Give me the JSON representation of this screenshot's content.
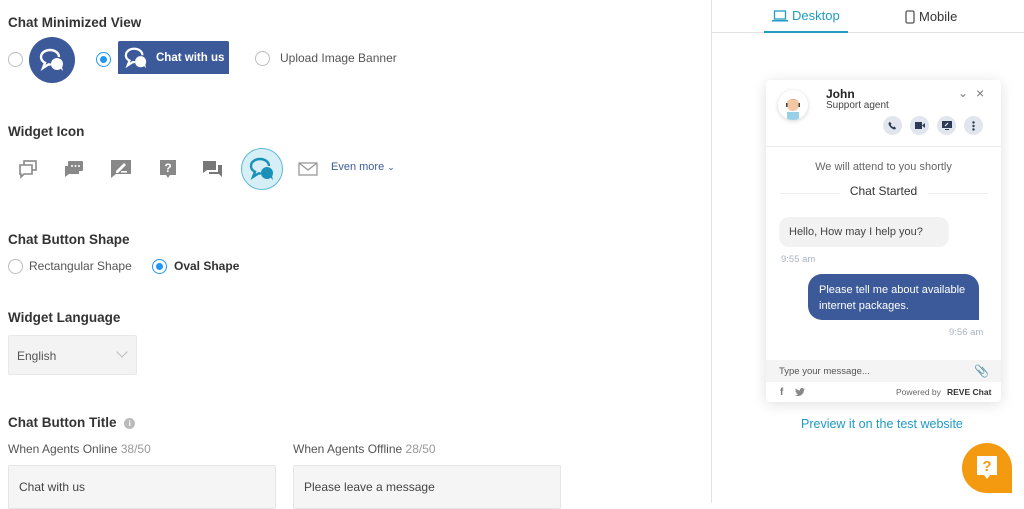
{
  "minimized_view": {
    "title": "Chat Minimized View",
    "options": [
      {
        "type": "round-icon",
        "selected": false
      },
      {
        "type": "rectangle",
        "label": "Chat with us",
        "selected": true
      },
      {
        "type": "banner",
        "label": "Upload Image Banner",
        "selected": false
      }
    ],
    "brand_color": "#3c5a99"
  },
  "widget_icon": {
    "title": "Widget Icon",
    "icons": [
      "chat-bubbles-outline-icon",
      "chat-dots-icon",
      "chat-pencil-icon",
      "chat-question-icon",
      "chat-double-icon",
      "chat-bubbles-selected-icon",
      "envelope-icon"
    ],
    "selected_index": 5,
    "even_more_label": "Even more"
  },
  "button_shape": {
    "title": "Chat Button Shape",
    "options": [
      {
        "label": "Rectangular Shape",
        "selected": false
      },
      {
        "label": "Oval Shape",
        "selected": true
      }
    ]
  },
  "language": {
    "title": "Widget Language",
    "selected": "English"
  },
  "button_title": {
    "title": "Chat Button Title",
    "online_label": "When Agents Online",
    "online_count": "38/50",
    "online_value": "Chat with us",
    "offline_label": "When Agents Offline",
    "offline_count": "28/50",
    "offline_value": "Please leave a message"
  },
  "preview": {
    "tabs": [
      {
        "label": "Desktop",
        "active": true
      },
      {
        "label": "Mobile",
        "active": false
      }
    ],
    "agent_name": "John",
    "agent_role": "Support agent",
    "system_message": "We will attend to you shortly",
    "chat_started": "Chat Started",
    "messages": [
      {
        "from": "agent",
        "text": "Hello, How may I help you?",
        "time": "9:55 am"
      },
      {
        "from": "visitor",
        "text": "Please tell me about available internet packages.",
        "time": "9:56 am"
      }
    ],
    "composer_placeholder": "Type your message...",
    "powered_by": "Powered by",
    "brand": "REVE Chat",
    "preview_link": "Preview it on the test website",
    "launcher_color": "#f39a11",
    "accent_color": "#1f9bc4"
  }
}
